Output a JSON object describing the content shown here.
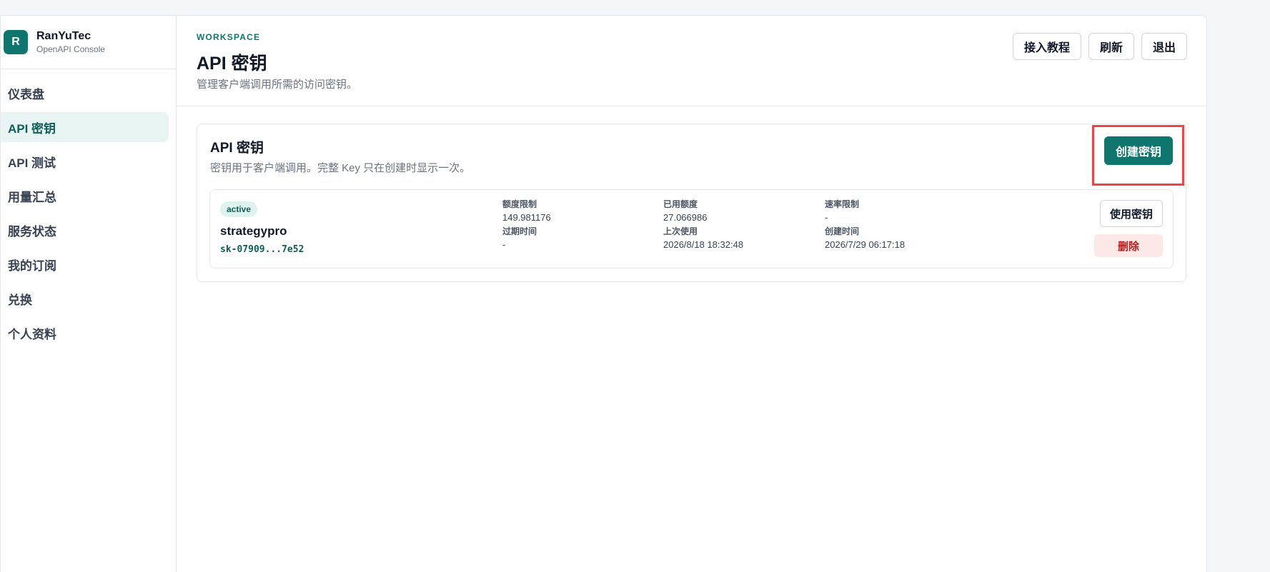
{
  "brand": {
    "logo_letter": "R",
    "name": "RanYuTec",
    "subtitle": "OpenAPI Console"
  },
  "sidebar": {
    "items": [
      {
        "label": "仪表盘",
        "active": false
      },
      {
        "label": "API 密钥",
        "active": true
      },
      {
        "label": "API 测试",
        "active": false
      },
      {
        "label": "用量汇总",
        "active": false
      },
      {
        "label": "服务状态",
        "active": false
      },
      {
        "label": "我的订阅",
        "active": false
      },
      {
        "label": "兑换",
        "active": false
      },
      {
        "label": "个人资料",
        "active": false
      }
    ]
  },
  "header": {
    "eyebrow": "WORKSPACE",
    "title": "API 密钥",
    "description": "管理客户端调用所需的访问密钥。",
    "actions": {
      "tutorial": "接入教程",
      "refresh": "刷新",
      "logout": "退出"
    }
  },
  "card": {
    "title": "API 密钥",
    "description": "密钥用于客户端调用。完整 Key 只在创建时显示一次。",
    "create_label": "创建密钥"
  },
  "keys": [
    {
      "status": "active",
      "name": "strategypro",
      "masked_key": "sk-07909...7e52",
      "quota_limit_label": "额度限制",
      "quota_limit": "149.981176",
      "used_quota_label": "已用额度",
      "used_quota": "27.066986",
      "rate_limit_label": "速率限制",
      "rate_limit": "-",
      "expires_label": "过期时间",
      "expires": "-",
      "last_used_label": "上次使用",
      "last_used": "2026/8/18 18:32:48",
      "created_label": "创建时间",
      "created": "2026/7/29 06:17:18",
      "use_label": "使用密钥",
      "delete_label": "删除"
    }
  ],
  "colors": {
    "accent": "#0f766e",
    "active_nav_bg": "#e8f4f1",
    "danger": "#b91c1c",
    "danger_bg": "#fde8e8",
    "highlight": "#ef4444"
  }
}
